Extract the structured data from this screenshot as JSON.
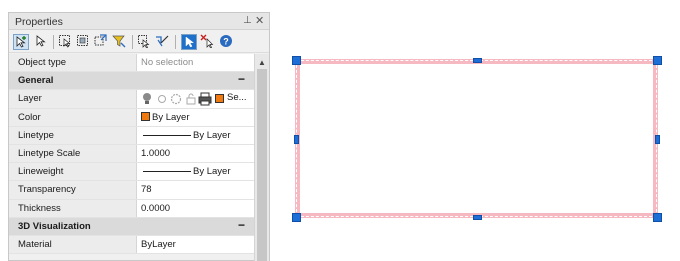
{
  "palette": {
    "title": "Properties",
    "pin_glyph": "⊥",
    "close_glyph": "✕"
  },
  "toolbar": {
    "icons": [
      "add-selection-icon",
      "select-icon",
      "quick-select-icon",
      "select-similar-icon",
      "toggle-pickadd-icon",
      "filter-icon",
      "select-objects-icon",
      "arrow-pointer-icon",
      "clear-selection-icon",
      "help-icon"
    ],
    "help_glyph": "?"
  },
  "properties": {
    "object_type": {
      "name": "Object type",
      "value": "No selection"
    },
    "general": {
      "label": "General",
      "collapse_glyph": "−",
      "layer": {
        "name": "Layer",
        "value": "Se..."
      },
      "color": {
        "name": "Color",
        "value": "By Layer",
        "swatch_color": "#f07a10"
      },
      "linetype": {
        "name": "Linetype",
        "value": "By Layer"
      },
      "linetype_scale": {
        "name": "Linetype Scale",
        "value": "1.0000"
      },
      "lineweight": {
        "name": "Lineweight",
        "value": "By Layer"
      },
      "transparency": {
        "name": "Transparency",
        "value": "78"
      },
      "thickness": {
        "name": "Thickness",
        "value": "0.0000"
      }
    },
    "visualization_3d": {
      "label": "3D Visualization",
      "collapse_glyph": "−",
      "material": {
        "name": "Material",
        "value": "ByLayer"
      }
    }
  },
  "scrollbar": {
    "up_glyph": "▲"
  },
  "canvas": {
    "rectangle": {
      "fill_color": "#ffffff",
      "edge_color": "#f7b9c1",
      "grip_color": "#1e6ed8"
    }
  }
}
